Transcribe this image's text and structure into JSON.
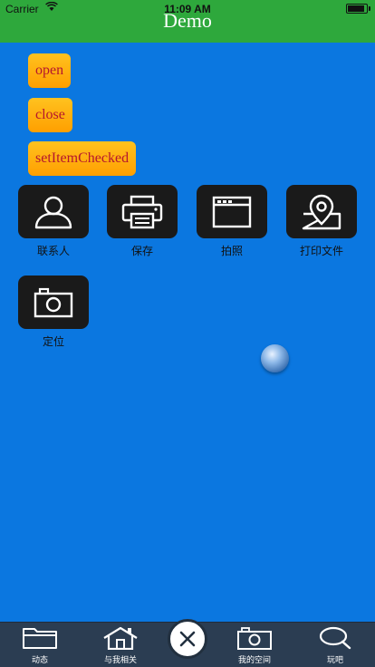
{
  "status_bar": {
    "carrier": "Carrier",
    "time": "11:09 AM"
  },
  "nav": {
    "title": "Demo",
    "background": "#2ea83c"
  },
  "buttons": {
    "open": "open",
    "close": "close",
    "set_item_checked": "setItemChecked"
  },
  "grid": [
    {
      "label": "联系人",
      "icon": "user-icon"
    },
    {
      "label": "保存",
      "icon": "printer-icon"
    },
    {
      "label": "拍照",
      "icon": "window-icon"
    },
    {
      "label": "打印文件",
      "icon": "location-map-icon"
    },
    {
      "label": "定位",
      "icon": "camera-icon"
    }
  ],
  "tabbar": {
    "tabs": [
      {
        "label": "动态",
        "icon": "folder-icon"
      },
      {
        "label": "与我相关",
        "icon": "home-icon"
      },
      {
        "label": "我的空间",
        "icon": "camera-icon"
      },
      {
        "label": "玩吧",
        "icon": "search-icon"
      }
    ],
    "center_icon": "close-icon"
  },
  "colors": {
    "page_background": "#0b77e0",
    "button_text": "#b5162e",
    "tabbar": "#2b3d52"
  }
}
